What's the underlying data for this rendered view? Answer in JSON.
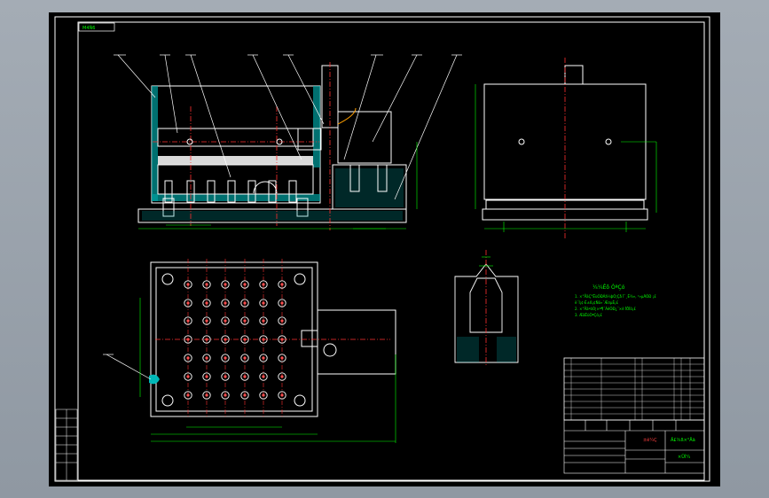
{
  "app": {
    "background": "#000000",
    "viewport_background": "#9aa2ab"
  },
  "colors": {
    "outline": "#ffffff",
    "centerline": "#ff3030",
    "dimension": "#00ff00",
    "hatch": "#00b8b8",
    "note_text": "#00ff00"
  },
  "title_block": {
    "stamp": "M4Ñ6",
    "drawing_name": "Ä£¾ß×°Åä",
    "code": "×ÜÍ¼",
    "label_left": "±ê¼Ç"
  },
  "technical_requirements": {
    "heading": "¼¼Êõ ÒªÇó",
    "lines": [
      "1. ×°ÅäÇ°ËùÓÐÁã¼þÓ¦Çå Ï´¸É¾», ²»µÃÓÐ ¡£",
      "ë´Ì¡¢·É±ß¡¢Ñõ»¯Æ¤µÈ¡£",
      "2. ×°ÅäºóÓ¦×ª¶¯ÁéÓÐ¿¨×è ÏÖÏó¡£",
      "3. ÆäËûÒªÇó¡£"
    ]
  },
  "icons": {
    "part_callout": "balloon-leader-icon",
    "detail_marker": "detail-c-icon"
  }
}
